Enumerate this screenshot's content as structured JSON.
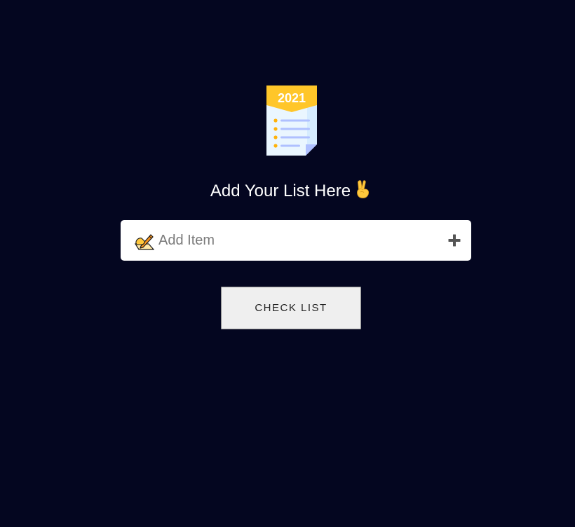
{
  "logo": {
    "year_text": "2021",
    "icon": "checklist-document-icon",
    "colors": {
      "banner": "#FFC629",
      "paper": "#EAF6FF",
      "lines": "#AFC0FF",
      "bullets": "#FFB20A"
    }
  },
  "heading": {
    "text": "Add Your List Here",
    "emoji_icon": "victory-hand-icon"
  },
  "input": {
    "placeholder": "Add Item",
    "value": "",
    "leading_icon": "writing-hand-icon",
    "add_icon": "plus-icon"
  },
  "check_button": {
    "label": "CHECK LIST"
  },
  "colors": {
    "background": "#040620",
    "text": "#FFFFFF",
    "plus": "#555555"
  }
}
